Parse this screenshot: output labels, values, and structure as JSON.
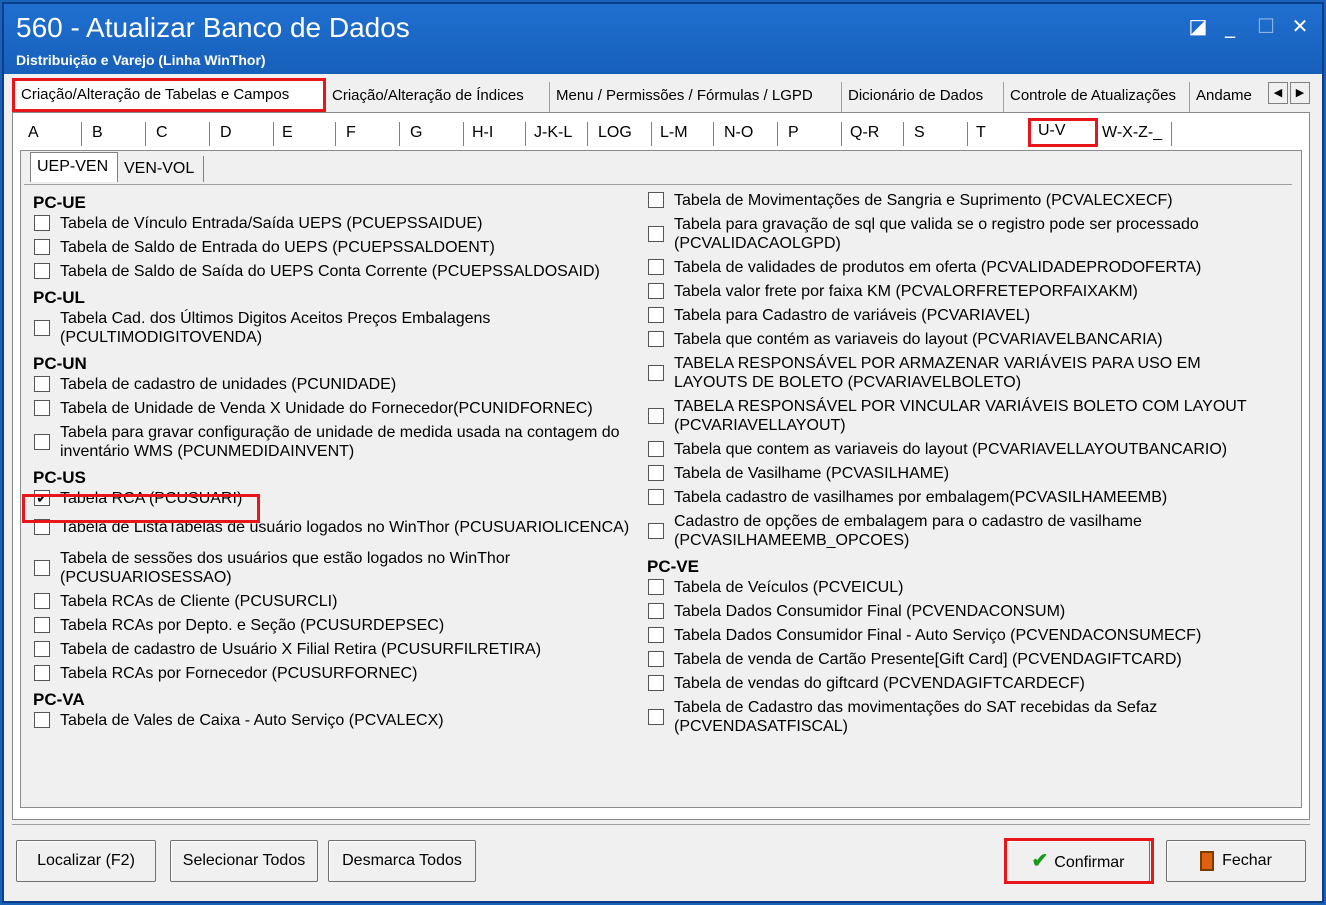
{
  "window": {
    "title": "560 - Atualizar Banco de Dados",
    "subtitle": "Distribuição e Varejo (Linha WinThor)",
    "controls": {
      "restore": "◪",
      "minimize": "_",
      "maximize": "☐",
      "close": "✕"
    }
  },
  "main_tabs": [
    "Criação/Alteração de Tabelas e Campos",
    "Criação/Alteração de Índices",
    "Menu / Permissões / Fórmulas / LGPD",
    "Dicionário de Dados",
    "Controle de Atualizações",
    "Andame"
  ],
  "letter_tabs": [
    "A",
    "B",
    "C",
    "D",
    "E",
    "F",
    "G",
    "H-I",
    "J-K-L",
    "LOG",
    "L-M",
    "N-O",
    "P",
    "Q-R",
    "S",
    "T",
    "U-V",
    "W-X-Z-_"
  ],
  "sub_tabs": [
    "UEP-VEN",
    "VEN-VOL"
  ],
  "left": {
    "groups": [
      {
        "name": "PC-UE",
        "items": [
          "Tabela de Vínculo Entrada/Saída UEPS (PCUEPSSAIDUE)",
          "Tabela de Saldo de Entrada do UEPS (PCUEPSSALDOENT)",
          "Tabela de Saldo de Saída do UEPS Conta Corrente (PCUEPSSALDOSAID)"
        ]
      },
      {
        "name": "PC-UL",
        "items": [
          "Tabela Cad. dos Últimos Digitos Aceitos Preços Embalagens (PCULTIMODIGITOVENDA)"
        ]
      },
      {
        "name": "PC-UN",
        "items": [
          "Tabela de cadastro de unidades (PCUNIDADE)",
          "Tabela de Unidade de Venda X Unidade do Fornecedor(PCUNIDFORNEC)",
          "Tabela para gravar configuração de unidade de medida usada na contagem do inventário WMS (PCUNMEDIDAINVENT)"
        ]
      },
      {
        "name": "PC-US",
        "items": [
          "Tabela RCA (PCUSUARI)",
          "Tabela de ListaTabelas de usuário logados no WinThor (PCUSUARIOLICENCA)",
          "Tabela de sessões dos usuários que estão logados no WinThor (PCUSUARIOSESSAO)",
          "Tabela RCAs de Cliente (PCUSURCLI)",
          "Tabela RCAs por Depto. e Seção (PCUSURDEPSEC)",
          "Tabela de cadastro de Usuário X Filial Retira (PCUSURFILRETIRA)",
          "Tabela RCAs por Fornecedor (PCUSURFORNEC)"
        ]
      },
      {
        "name": "PC-VA",
        "items": [
          "Tabela de Vales de Caixa - Auto Serviço (PCVALECX)"
        ]
      }
    ]
  },
  "right": {
    "items_top": [
      "Tabela de Movimentações de Sangria e Suprimento (PCVALECXECF)",
      "Tabela para gravação de sql que valida se o registro pode ser processado (PCVALIDACAOLGPD)",
      "Tabela de validades de produtos em oferta (PCVALIDADEPRODOFERTA)",
      "Tabela valor frete por faixa KM (PCVALORFRETEPORFAIXAKM)",
      "Tabela para Cadastro de variáveis (PCVARIAVEL)",
      "Tabela que contém as variaveis do layout (PCVARIAVELBANCARIA)",
      "TABELA RESPONSÁVEL POR ARMAZENAR VARIÁVEIS PARA USO EM LAYOUTS DE BOLETO (PCVARIAVELBOLETO)",
      "TABELA RESPONSÁVEL POR VINCULAR VARIÁVEIS BOLETO COM LAYOUT (PCVARIAVELLAYOUT)",
      "Tabela que contem as variaveis do layout (PCVARIAVELLAYOUTBANCARIO)",
      "Tabela de Vasilhame (PCVASILHAME)",
      "Tabela cadastro de vasilhames por embalagem(PCVASILHAMEEMB)",
      "Cadastro de opções de embalagem para o cadastro de vasilhame (PCVASILHAMEEMB_OPCOES)"
    ],
    "group_ve": "PC-VE",
    "items_ve": [
      "Tabela de Veículos (PCVEICUL)",
      "Tabela Dados Consumidor Final  (PCVENDACONSUM)",
      "Tabela Dados Consumidor Final - Auto Serviço (PCVENDACONSUMECF)",
      "Tabela de venda de Cartão Presente[Gift Card] (PCVENDAGIFTCARD)",
      "Tabela de vendas do giftcard (PCVENDAGIFTCARDECF)",
      "Tabela de Cadastro das movimentações do SAT recebidas da Sefaz (PCVENDASATFISCAL)"
    ]
  },
  "checked_item": "Tabela RCA (PCUSUARI)",
  "buttons": {
    "localizar": "Localizar (F2)",
    "selecionar": "Selecionar Todos",
    "desmarca": "Desmarca Todos",
    "confirmar": "Confirmar",
    "fechar": "Fechar"
  },
  "icons": {
    "confirm": "check-icon",
    "close": "door-icon",
    "scroll_left": "◀",
    "scroll_right": "▶",
    "check": "✔"
  },
  "colors": {
    "title_bar": "#1f6fd0",
    "highlight": "#e8151b",
    "confirm_check": "#1a9a1a"
  }
}
